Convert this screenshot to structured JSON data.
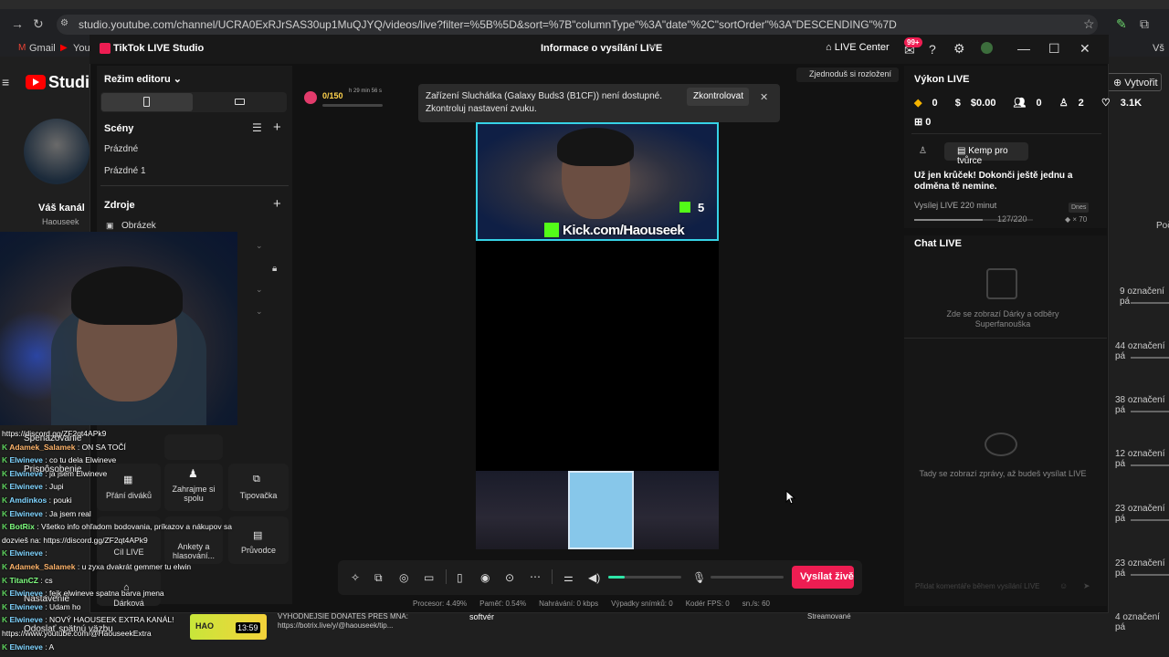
{
  "browser": {
    "url": "studio.youtube.com/channel/UCRA0ExRJrSAS30up1MuQJYQ/videos/live?filter=%5B%5D&sort=%7B\"columnType\"%3A\"date\"%2C\"sortOrder\"%3A\"DESCENDING\"%7D",
    "bookmarks": [
      "Gmail",
      "You"
    ]
  },
  "yt_studio": {
    "logo_text": "Studio",
    "channel_name": "Váš kanál",
    "channel_handle": "Haouseek",
    "create_label": "Vytvořit",
    "right_labels": [
      "Poč",
      "9 označení pá",
      "44 označení pá",
      "38 označení pá",
      "12 označení pá",
      "23 označení pá",
      "23 označení pá",
      "4 označení pá"
    ],
    "bottom_donate_title": "VYHODNEJSIE DONATES PRES MNA:",
    "bottom_donate_url": "https://botrix.live/y/@haouseek/tip...",
    "bottom_thumb_time": "13:59",
    "bottom_thumb_label": "HAO",
    "bottom_category": "softvér",
    "bottom_status": "Streamované"
  },
  "tiktok": {
    "app_title": "TikTok LIVE Studio",
    "center_title": "Informace o vysílání LIVE",
    "live_center": "LIVE Center",
    "notif_badge": "99+",
    "editor_mode": "Režim editoru",
    "scenes_label": "Scény",
    "scenes": [
      "Prázdné",
      "Prázdné 1"
    ],
    "sources_label": "Zdroje",
    "sources": [
      "Obrázek"
    ],
    "tools": [
      {
        "label": "Přání diváků"
      },
      {
        "label": "Zahrajme si spolu"
      },
      {
        "label": "Tipovačka"
      },
      {
        "label": "Cíl LIVE"
      },
      {
        "label": "Ankety a hlasování..."
      },
      {
        "label": "Průvodce"
      },
      {
        "label": "Dárková"
      }
    ],
    "left_menu_fragments": [
      "Spenazovanie",
      "Prispôsobenie",
      "Nastavenie",
      "Odoslať spätnú väzbu"
    ],
    "gift_goal": "0/150",
    "gift_goal_time": "h 29 min 56 s",
    "toast": {
      "message": "Zařízení Sluchátka (Galaxy Buds3 (B1CF)) není dostupné. Zkontroluj nastavení zvuku.",
      "button": "Zkontrolovat"
    },
    "preview": {
      "kick_url": "Kick.com/Haouseek",
      "kick_count": "5"
    },
    "go_live": "Vysílat živě",
    "stats": [
      "Procesor: 4.49%",
      "Paměť: 0.54%",
      "Nahrávání: 0 kbps",
      "Výpadky snímků: 0",
      "Kodér FPS: 0",
      "sn./s: 60"
    ],
    "simplify": "Zjednoduš si rozložení",
    "perf": {
      "title": "Výkon LIVE",
      "diamonds": "0",
      "earnings": "$0.00",
      "viewers": "0",
      "new_followers": "2",
      "likes": "3.1K",
      "gifts": "0"
    },
    "creator_camp": "Kemp pro tvůrce",
    "promo": {
      "headline": "Už jen krůček! Dokonči ještě jednu a odměna tě nemine.",
      "task": "Vysílej LIVE 220 minut",
      "badge": "Dnes",
      "progress_text": "127/220",
      "multiplier": "× 70",
      "progress": 0.577
    },
    "chat": {
      "title": "Chat LIVE",
      "gifts_empty": "Zde se zobrazí Dárky a odběry Superfanouška",
      "messages_empty": "Tady se zobrazí zprávy, až budeš vysílat LIVE",
      "input_placeholder": "Přidat komentáře během vysílání LIVE"
    },
    "volume_level": 0.22
  },
  "overlay_chat": [
    {
      "name": "",
      "text": "https://discord.gg/ZF2qt4APk9",
      "color": "w"
    },
    {
      "name": "Adamek_Salamek",
      "text": ": ON SA TOČÍ",
      "color": "o"
    },
    {
      "name": "Elwineve",
      "text": ": co tu dela Elwineve",
      "color": "b"
    },
    {
      "name": "Elwineve",
      "text": ": ja jsem Elwineve",
      "color": "b"
    },
    {
      "name": "Elwineve",
      "text": ": Jupi",
      "color": "b"
    },
    {
      "name": "Amdinkos",
      "text": ": pouki",
      "color": "b"
    },
    {
      "name": "Elwineve",
      "text": ": Ja jsem real",
      "color": "b"
    },
    {
      "name": "BotRix",
      "text": ": Všetko info ohľadom bodovania, príkazov a nákupov sa",
      "color": "g"
    },
    {
      "name": "",
      "text": "dozvieš na: https://discord.gg/ZF2qt4APk9",
      "color": "w"
    },
    {
      "name": "Elwineve",
      "text": ":",
      "color": "b"
    },
    {
      "name": "Adamek_Salamek",
      "text": ": u zyxa dvakrát gemmer tu elwin",
      "color": "o"
    },
    {
      "name": "TitanCZ",
      "text": ": cs",
      "color": "g"
    },
    {
      "name": "Elwineve",
      "text": ": fejk elwineve spatna barva jmena",
      "color": "b"
    },
    {
      "name": "Elwineve",
      "text": ": Udam ho",
      "color": "b"
    },
    {
      "name": "Elwineve",
      "text": ": NOVÝ HAOUSEEK EXTRA KANÁL!",
      "color": "b"
    },
    {
      "name": "",
      "text": "https://www.youtube.com/@HaouseekExtra",
      "color": "w"
    },
    {
      "name": "Elwineve",
      "text": ": A",
      "color": "b"
    }
  ]
}
